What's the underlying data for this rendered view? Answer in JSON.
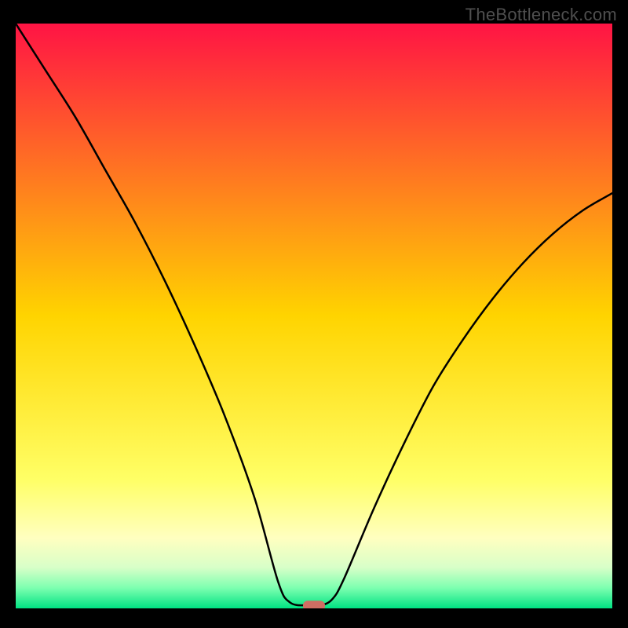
{
  "watermark": "TheBottleneck.com",
  "chart_data": {
    "type": "line",
    "title": "",
    "xlabel": "",
    "ylabel": "",
    "xlim": [
      0,
      100
    ],
    "ylim": [
      0,
      100
    ],
    "x": [
      0,
      5,
      10,
      15,
      20,
      25,
      30,
      35,
      40,
      44,
      46,
      49,
      51,
      53,
      55,
      60,
      65,
      70,
      75,
      80,
      85,
      90,
      95,
      100
    ],
    "values": [
      100,
      92,
      84,
      75,
      66,
      56,
      45,
      33,
      19,
      4.5,
      1.0,
      0.5,
      0.5,
      1.5,
      5,
      17,
      28,
      38,
      46,
      53,
      59,
      64,
      68,
      71
    ],
    "marker": {
      "x": 50,
      "y": 0.5,
      "color": "#cf6e63"
    },
    "gradient_stops": [
      {
        "offset": 0.0,
        "color": "#ff1444"
      },
      {
        "offset": 0.5,
        "color": "#ffd400"
      },
      {
        "offset": 0.78,
        "color": "#ffff66"
      },
      {
        "offset": 0.88,
        "color": "#ffffc0"
      },
      {
        "offset": 0.93,
        "color": "#d8ffc8"
      },
      {
        "offset": 0.965,
        "color": "#7dffb0"
      },
      {
        "offset": 1.0,
        "color": "#00e383"
      }
    ]
  }
}
